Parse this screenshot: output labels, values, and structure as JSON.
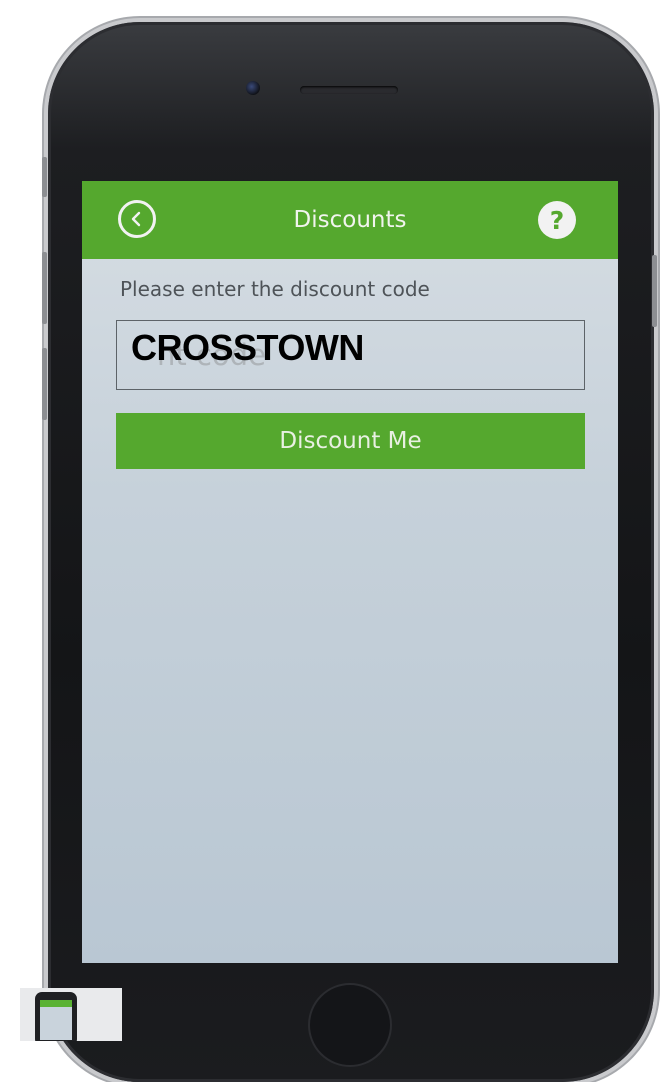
{
  "header": {
    "title": "Discounts",
    "back_icon": "chevron-left-circle-icon",
    "help_label": "?"
  },
  "form": {
    "prompt": "Please enter the discount code",
    "placeholder_visible": "nt code",
    "typed_value": "CROSSTOWN",
    "submit_label": "Discount Me"
  },
  "colors": {
    "accent_green": "#55a82e",
    "screen_bg": "#c6d1da"
  }
}
